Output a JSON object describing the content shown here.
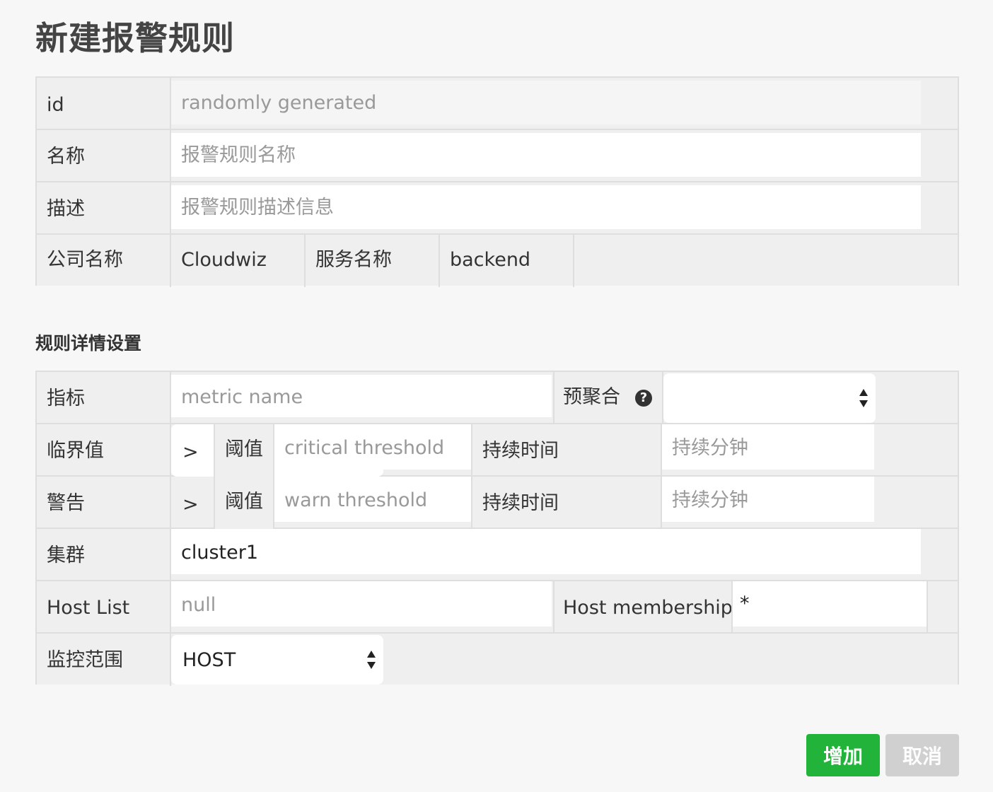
{
  "page": {
    "title": "新建报警规则"
  },
  "basic": {
    "id_label": "id",
    "id_placeholder": "randomly generated",
    "name_label": "名称",
    "name_placeholder": "报警规则名称",
    "desc_label": "描述",
    "desc_placeholder": "报警规则描述信息",
    "company_label": "公司名称",
    "company_value": "Cloudwiz",
    "service_label": "服务名称",
    "service_value": "backend"
  },
  "details": {
    "section_title": "规则详情设置",
    "metric_label": "指标",
    "metric_placeholder": "metric name",
    "preagg_label": "预聚合",
    "help_icon": "?",
    "preagg_value": "",
    "critical_label": "临界值",
    "critical_op": ">",
    "critical_threshold_label": "阈值",
    "critical_placeholder": "critical threshold",
    "critical_duration_label": "持续时间",
    "critical_duration_placeholder": "持续分钟",
    "warn_label": "警告",
    "warn_op": ">",
    "warn_threshold_label": "阈值",
    "warn_placeholder": "warn threshold",
    "warn_duration_label": "持续时间",
    "warn_duration_placeholder": "持续分钟",
    "cluster_label": "集群",
    "cluster_value": "cluster1",
    "hostlist_label": "Host List",
    "hostlist_placeholder": "null",
    "membership_label": "Host membership",
    "membership_value": "*",
    "scope_label": "监控范围",
    "scope_value": "HOST"
  },
  "actions": {
    "add_label": "增加",
    "cancel_label": "取消"
  },
  "colors": {
    "primary": "#22b43a",
    "muted": "#d0d0d0"
  }
}
